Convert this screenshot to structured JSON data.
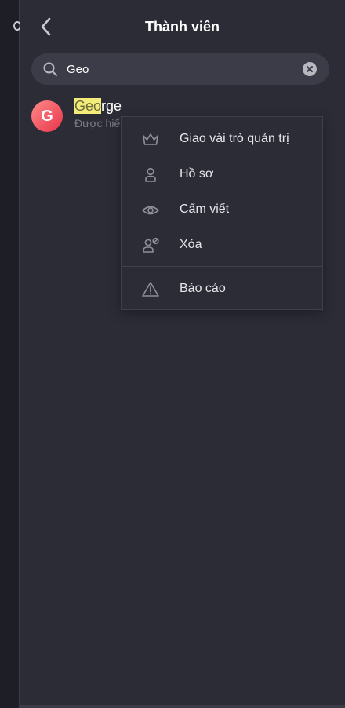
{
  "header": {
    "title": "Thành viên"
  },
  "search": {
    "value": "Geo"
  },
  "member": {
    "avatar_letter": "G",
    "name_highlight": "Geo",
    "name_rest": "rge",
    "subtitle": "Được hiể"
  },
  "context_menu": {
    "items": [
      {
        "label": "Giao vài trò quản trị",
        "icon": "crown-icon"
      },
      {
        "label": "Hồ sơ",
        "icon": "user-icon"
      },
      {
        "label": "Cấm viết",
        "icon": "eye-icon"
      },
      {
        "label": "Xóa",
        "icon": "user-remove-icon"
      },
      {
        "label": "Báo cáo",
        "icon": "warning-icon"
      }
    ]
  },
  "colors": {
    "panel_bg": "#2b2c36",
    "highlight": "#f4ec7a",
    "avatar_start": "#ff8a8a",
    "avatar_end": "#e8344a"
  }
}
